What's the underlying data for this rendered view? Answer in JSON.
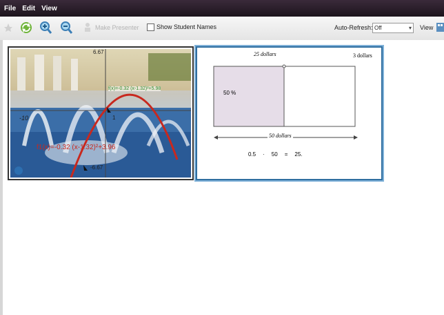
{
  "menu": {
    "file": "File",
    "edit": "Edit",
    "view": "View"
  },
  "toolbar": {
    "make_presenter": "Make Presenter",
    "show_student_names": "Show Student Names",
    "auto_refresh_label": "Auto-Refresh:",
    "auto_refresh_value": "Off",
    "view_label": "View"
  },
  "thumbnail1": {
    "graph_label_green_prefix": "f",
    "graph_label_green": "f(x)=-0.32 (x-1.32)²+5.98",
    "graph_label_red": "f1(x)=-0.32 (x-1.32)²+3.96",
    "x_min_label": "-10",
    "x_tick_label": "1",
    "y_top_label": "6.67",
    "y_bottom_label": "-6.67"
  },
  "thumbnail2": {
    "top_label": "25 dollars",
    "right_label": "3 dollars",
    "percent_label": "50 %",
    "bottom_label": "50 dollars",
    "eq_a": "0.5",
    "eq_op": "·",
    "eq_b": "50",
    "eq_eq": "=",
    "eq_result": "25."
  },
  "colors": {
    "curve": "#c8281e",
    "green_label": "#2f8a2f",
    "shaded": "#e6dde8",
    "thumb2_border": "#2f6ea0"
  }
}
